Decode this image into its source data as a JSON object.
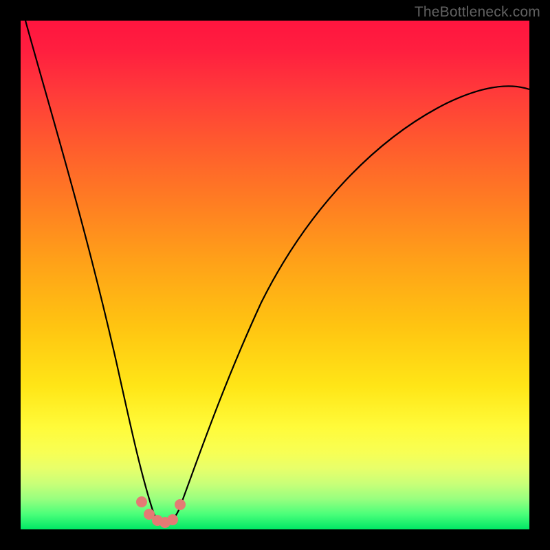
{
  "watermark": "TheBottleneck.com",
  "colors": {
    "page_bg": "#000000",
    "curve_stroke": "#000000",
    "marker_fill": "#e47a74",
    "gradient_top": "#ff153f",
    "gradient_bottom": "#00e765"
  },
  "chart_data": {
    "type": "line",
    "title": "",
    "xlabel": "",
    "ylabel": "",
    "xlim": [
      0,
      100
    ],
    "ylim": [
      0,
      100
    ],
    "grid": false,
    "legend": false,
    "series": [
      {
        "name": "bottleneck-curve",
        "x": [
          1,
          4,
          8,
          12,
          15,
          17,
          19,
          21,
          23,
          24.5,
          25.5,
          27,
          28,
          29,
          30,
          31.5,
          33,
          36,
          40,
          46,
          54,
          64,
          78,
          92,
          100
        ],
        "values": [
          100,
          88,
          72,
          56,
          43,
          34,
          25,
          17,
          10,
          5,
          3,
          1.5,
          1,
          1,
          1.5,
          3,
          6,
          15,
          27,
          42,
          56,
          67,
          77,
          83,
          86
        ]
      }
    ],
    "markers": {
      "name": "bottom-cluster",
      "x": [
        23.5,
        25,
        26.5,
        28,
        29.5,
        31
      ],
      "values": [
        5.2,
        2.8,
        1.8,
        1.3,
        1.8,
        4.6
      ]
    },
    "background_gradient": {
      "orientation": "vertical",
      "stops": [
        {
          "pos": 0.0,
          "color": "#ff153f"
        },
        {
          "pos": 0.14,
          "color": "#ff3a3a"
        },
        {
          "pos": 0.36,
          "color": "#ff7e22"
        },
        {
          "pos": 0.6,
          "color": "#ffc411"
        },
        {
          "pos": 0.8,
          "color": "#fffb3a"
        },
        {
          "pos": 0.94,
          "color": "#98ff7f"
        },
        {
          "pos": 1.0,
          "color": "#00e765"
        }
      ]
    }
  }
}
